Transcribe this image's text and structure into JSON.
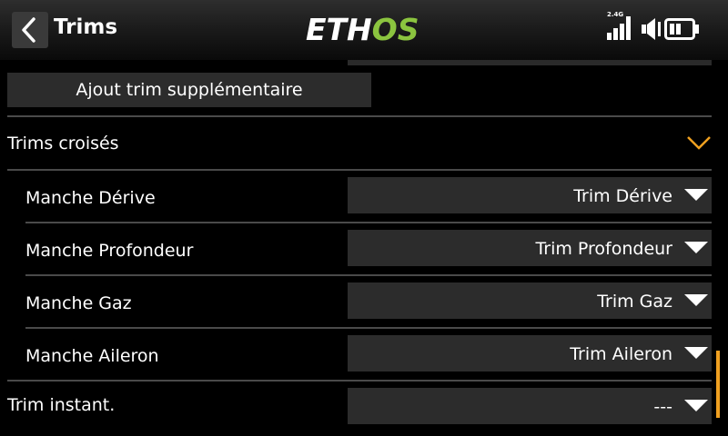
{
  "header": {
    "title": "Trims",
    "logo_part1": "ETH",
    "logo_part2": "OS",
    "rf_band": "2.4G"
  },
  "colors": {
    "accent": "#f0a020",
    "logo_green": "#8bc43f",
    "field_bg": "#2c2c2c"
  },
  "main": {
    "add_trim_label": "Ajout trim supplémentaire",
    "cross_trims": {
      "label": "Trims croisés",
      "expanded": true,
      "rows": [
        {
          "label": "Manche Dérive",
          "value": "Trim Dérive"
        },
        {
          "label": "Manche Profondeur",
          "value": "Trim Profondeur"
        },
        {
          "label": "Manche Gaz",
          "value": "Trim Gaz"
        },
        {
          "label": "Manche Aileron",
          "value": "Trim Aileron"
        }
      ]
    },
    "instant_trim": {
      "label": "Trim instant.",
      "value": "---"
    }
  },
  "icons": [
    "back-arrow-icon",
    "signal-icon",
    "speaker-icon",
    "battery-icon",
    "chevron-down-icon",
    "dropdown-triangle-icon"
  ]
}
